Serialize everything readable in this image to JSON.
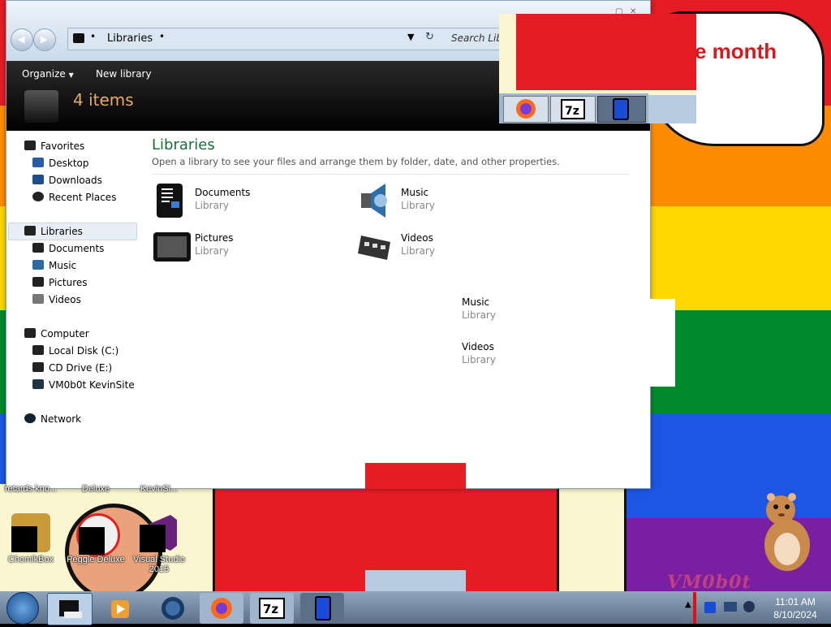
{
  "window": {
    "breadcrumb": "Libraries",
    "search_placeholder": "Search Libr",
    "organize_label": "Organize",
    "new_library_label": "New library",
    "item_count": "4 items"
  },
  "sidebar": {
    "favorites": {
      "label": "Favorites",
      "items": [
        {
          "label": "Desktop"
        },
        {
          "label": "Downloads"
        },
        {
          "label": "Recent Places"
        }
      ]
    },
    "libraries": {
      "label": "Libraries",
      "items": [
        {
          "label": "Documents"
        },
        {
          "label": "Music"
        },
        {
          "label": "Pictures"
        },
        {
          "label": "Videos"
        }
      ]
    },
    "computer": {
      "label": "Computer",
      "items": [
        {
          "label": "Local Disk (C:)"
        },
        {
          "label": "CD Drive (E:)"
        },
        {
          "label": "VM0b0t KevinSite"
        }
      ]
    },
    "network": {
      "label": "Network"
    }
  },
  "content": {
    "title": "Libraries",
    "description": "Open a library to see your files and arrange them by folder, date, and other properties.",
    "libraries": [
      {
        "name": "Documents",
        "type": "Library"
      },
      {
        "name": "Music",
        "type": "Library"
      },
      {
        "name": "Pictures",
        "type": "Library"
      },
      {
        "name": "Videos",
        "type": "Library"
      }
    ],
    "ghost": [
      {
        "name": "Music",
        "type": "Library"
      },
      {
        "name": "Videos",
        "type": "Library"
      }
    ]
  },
  "overlay": {
    "banner_text": "e month",
    "thumbnails": [
      "firefox-icon",
      "7zip-icon",
      "phone-icon"
    ]
  },
  "desktop": {
    "partial_labels": [
      "retards kno...",
      "Deluxe",
      "KevinSi..."
    ],
    "icons": [
      {
        "label": "ChomikBox"
      },
      {
        "label": "Peggle Deluxe"
      },
      {
        "label": "Visual Studio 2015"
      }
    ],
    "watermark": "VM0b0t"
  },
  "taskbar": {
    "buttons": [
      "start-orb-icon",
      "explorer-icon",
      "media-player-icon",
      "globe-icon",
      "firefox-icon",
      "7zip-icon",
      "phone-icon"
    ],
    "clock_time": "11:01 AM",
    "clock_date": "8/10/2024"
  },
  "colors": {
    "rainbow": [
      "#e31d23",
      "#ff8c00",
      "#ffd700",
      "#008a2e",
      "#1d55e5",
      "#7a1fa2"
    ],
    "library_title": "#1e6b3b",
    "banner_text": "#d31a1f"
  }
}
